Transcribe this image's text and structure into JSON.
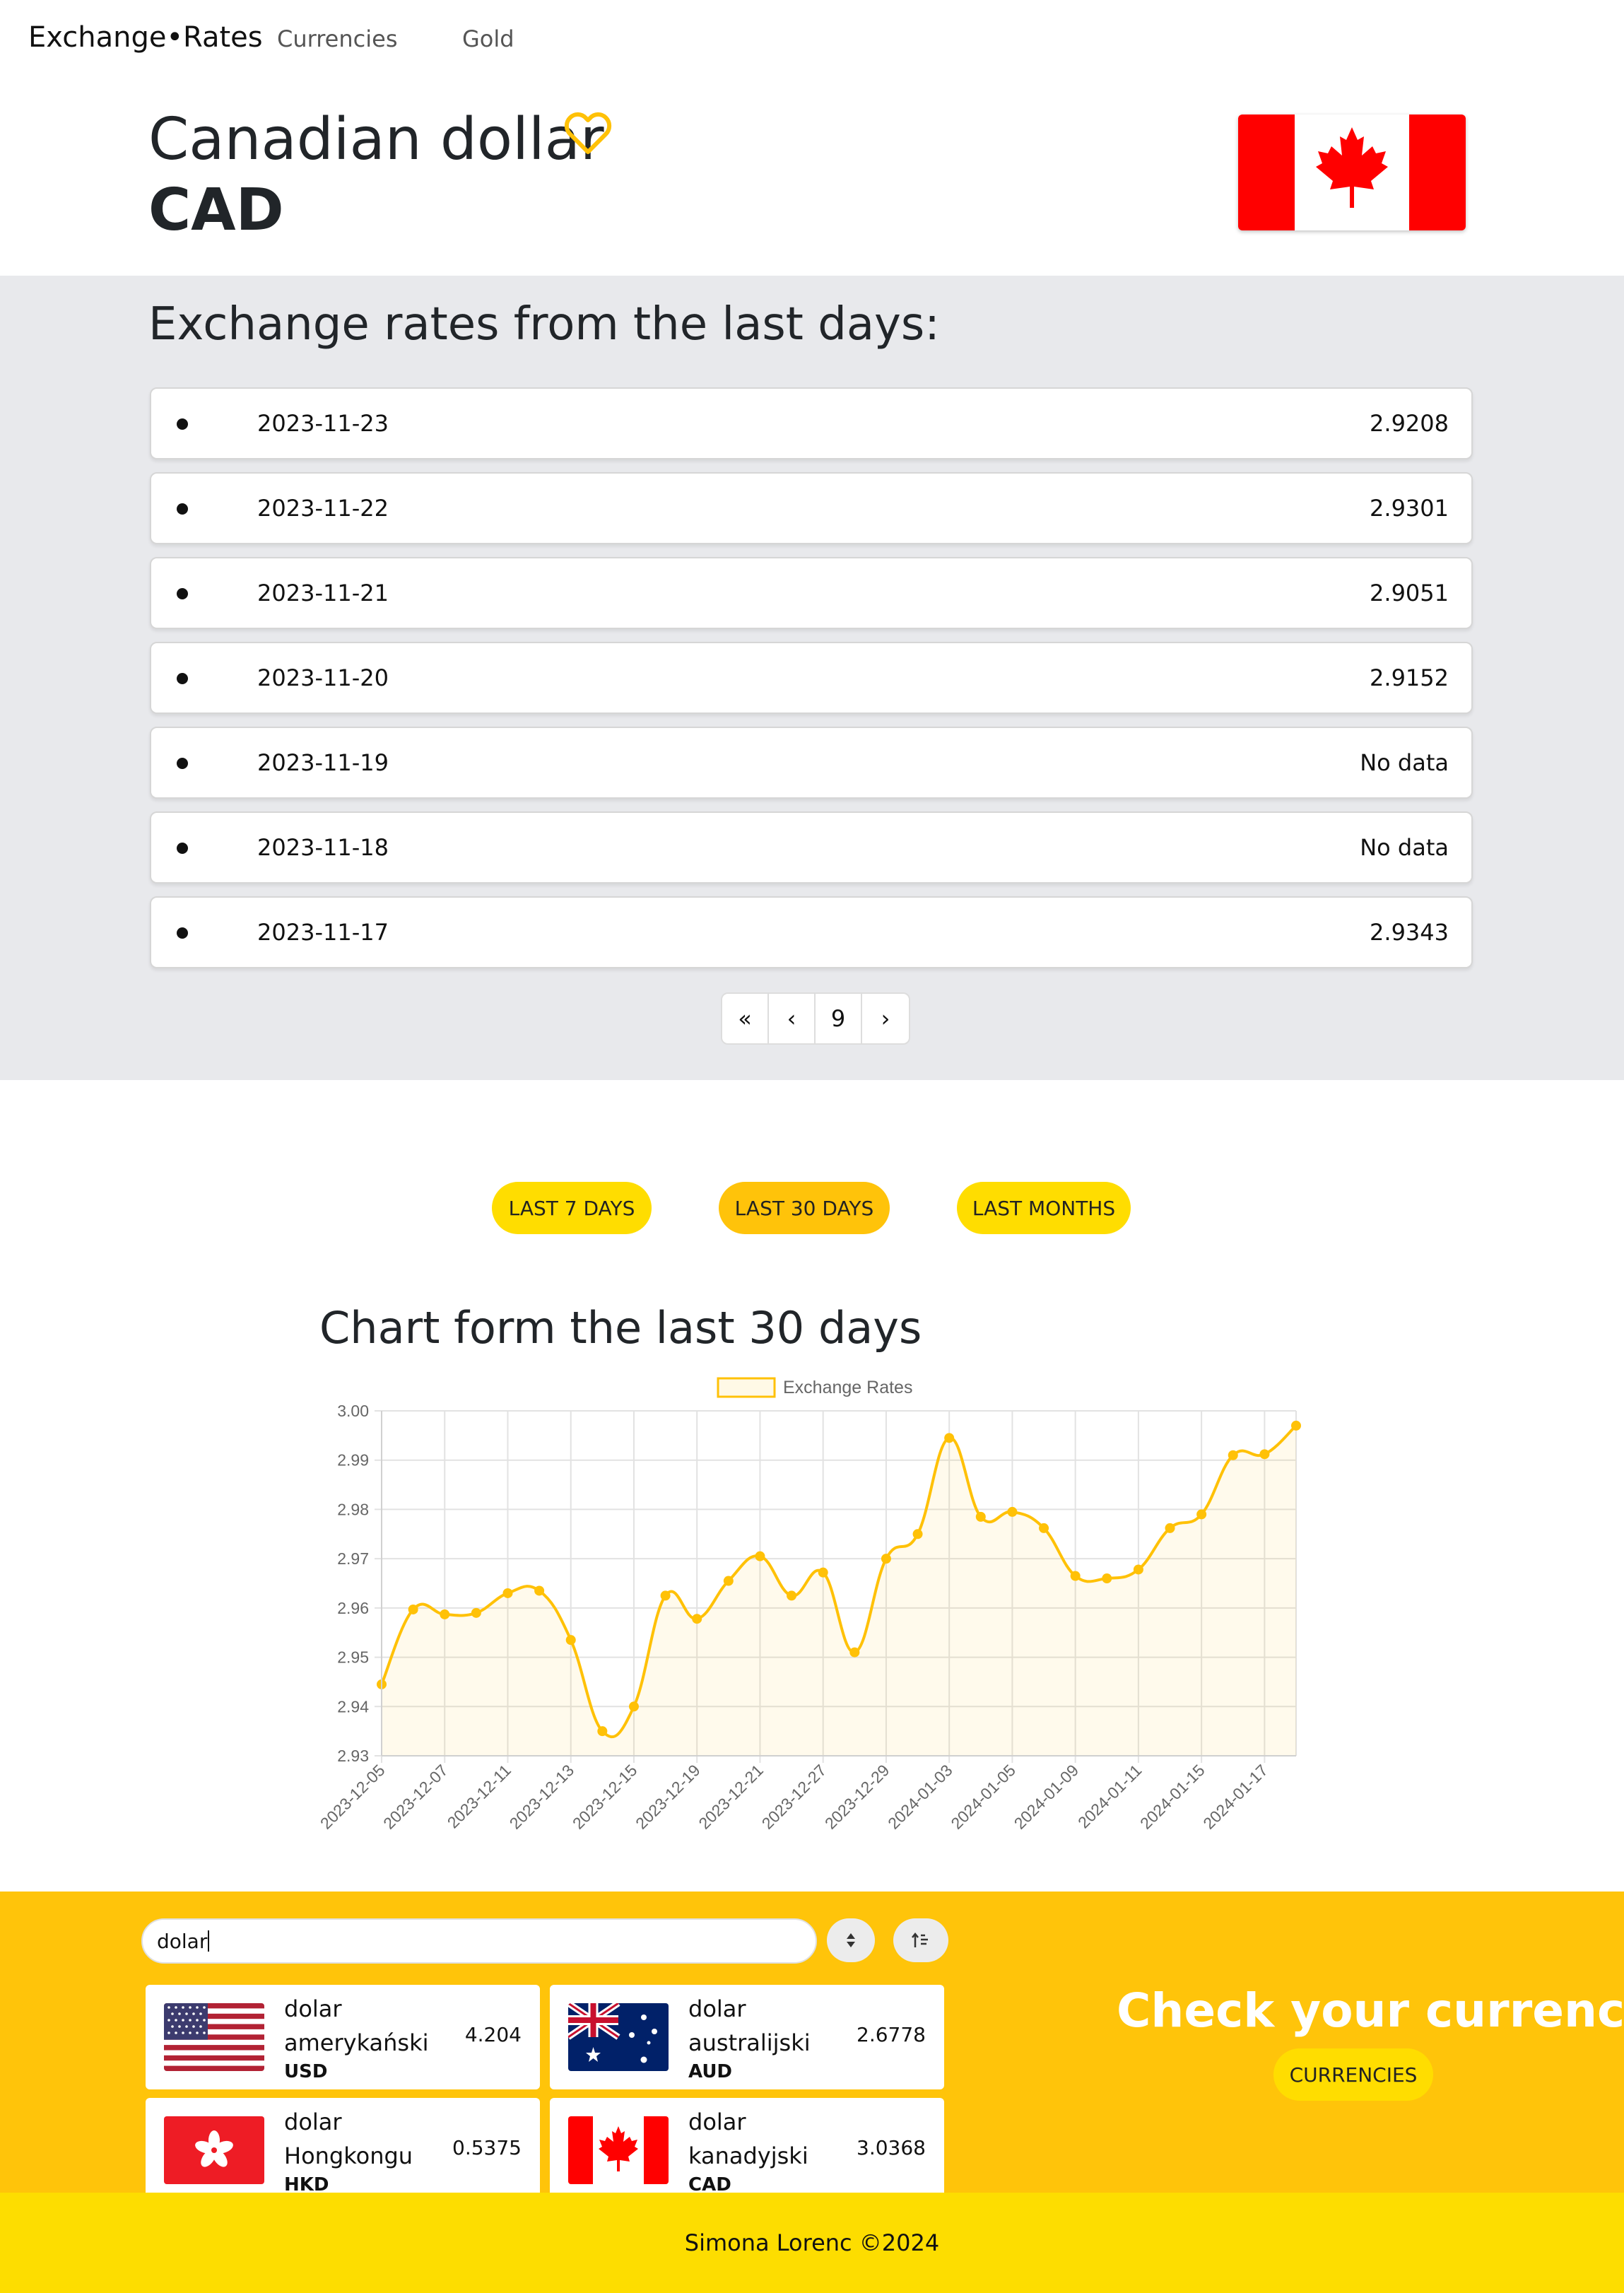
{
  "nav": {
    "brand": "Exchange•Rates",
    "links": [
      "Currencies",
      "Gold"
    ]
  },
  "currency": {
    "name": "Canadian dollar",
    "code": "CAD"
  },
  "rates_section": {
    "title": "Exchange rates from the last days:",
    "items": [
      {
        "date": "2023-11-23",
        "value": "2.9208"
      },
      {
        "date": "2023-11-22",
        "value": "2.9301"
      },
      {
        "date": "2023-11-21",
        "value": "2.9051"
      },
      {
        "date": "2023-11-20",
        "value": "2.9152"
      },
      {
        "date": "2023-11-19",
        "value": "No data"
      },
      {
        "date": "2023-11-18",
        "value": "No data"
      },
      {
        "date": "2023-11-17",
        "value": "2.9343"
      }
    ],
    "pagination": {
      "first": "«",
      "prev": "‹",
      "page": "9",
      "next": "›"
    }
  },
  "period_buttons": [
    "LAST 7 DAYS",
    "LAST 30 DAYS",
    "LAST MONTHS"
  ],
  "chart_title": "Chart form the last 30 days",
  "chart_data": {
    "type": "line",
    "legend": "Exchange Rates",
    "legend_position": "top",
    "grid": true,
    "ylim": [
      2.93,
      3.0
    ],
    "yticks": [
      "3.00",
      "2.99",
      "2.98",
      "2.97",
      "2.96",
      "2.95",
      "2.94",
      "2.93"
    ],
    "x_tick_labels": [
      "2023-12-05",
      "2023-12-07",
      "2023-12-11",
      "2023-12-13",
      "2023-12-15",
      "2023-12-19",
      "2023-12-21",
      "2023-12-27",
      "2023-12-29",
      "2024-01-03",
      "2024-01-05",
      "2024-01-09",
      "2024-01-11",
      "2024-01-15",
      "2024-01-17"
    ],
    "series": [
      {
        "name": "Exchange Rates",
        "values": [
          2.9445,
          2.9597,
          2.9587,
          2.959,
          2.963,
          2.9635,
          2.9535,
          2.935,
          2.94,
          2.9625,
          2.9578,
          2.9655,
          2.9705,
          2.9625,
          2.9672,
          2.951,
          2.97,
          2.975,
          2.9945,
          2.9785,
          2.9795,
          2.9762,
          2.9665,
          2.966,
          2.9678,
          2.9762,
          2.979,
          2.991,
          2.9912,
          2.997
        ]
      }
    ],
    "color": "#ffc107"
  },
  "search": {
    "value": "dolar"
  },
  "cards": [
    {
      "name": "dolar amerykański",
      "code": "USD",
      "value": "4.204"
    },
    {
      "name": "dolar australijski",
      "code": "AUD",
      "value": "2.6778"
    },
    {
      "name": "dolar Hongkongu",
      "code": "HKD",
      "value": "0.5375"
    },
    {
      "name": "dolar kanadyjski",
      "code": "CAD",
      "value": "3.0368"
    }
  ],
  "promo": {
    "title": "Check your currency!",
    "button": "CURRENCIES"
  },
  "footer": {
    "text": "Simona Lorenc ©2024"
  },
  "colors": {
    "accent": "#ffc107",
    "yellow_section": "#ffc40a",
    "footer": "#fddd00",
    "button": "#ffdd00"
  }
}
